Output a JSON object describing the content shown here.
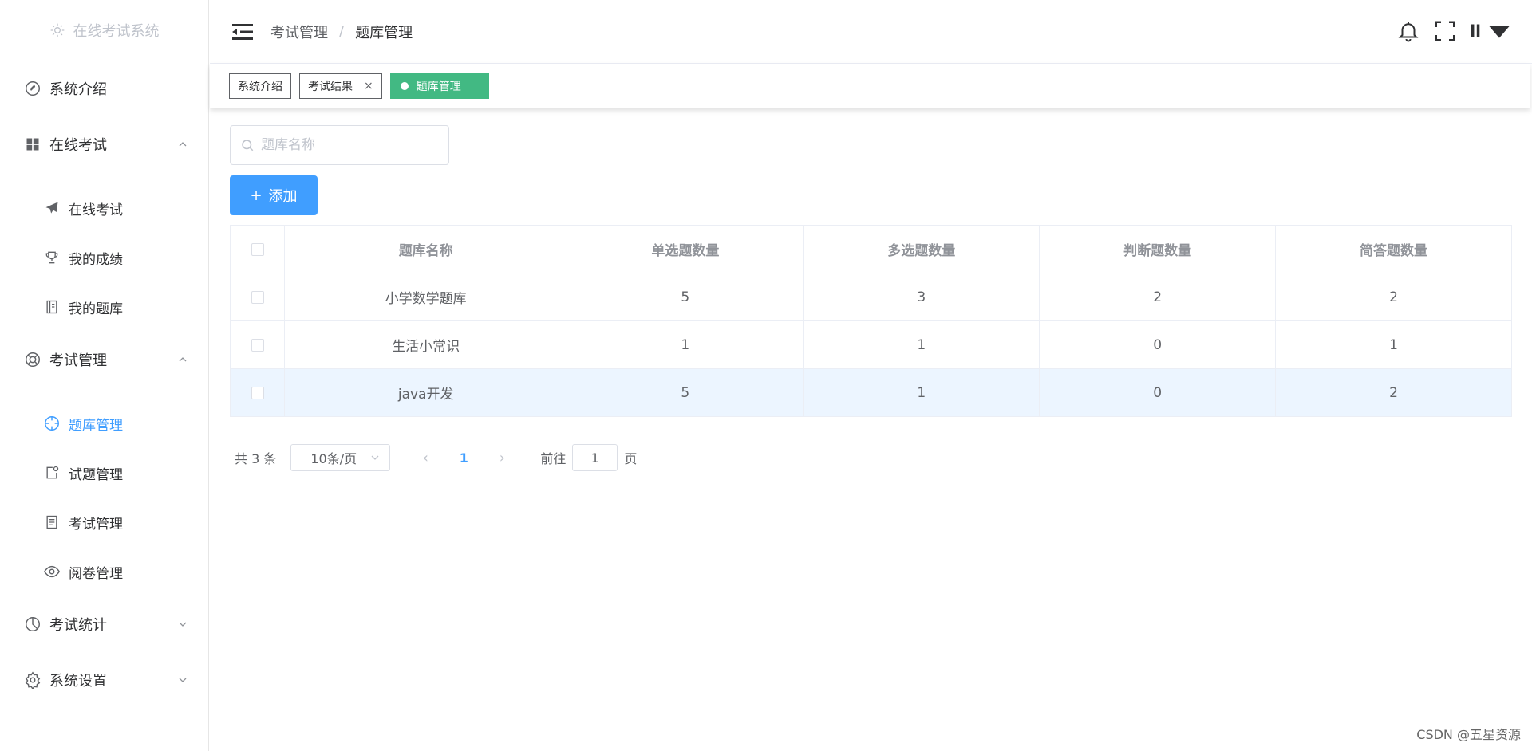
{
  "sidebar": {
    "logo_text": "在线考试系统",
    "items": [
      {
        "label": "系统介绍"
      },
      {
        "label": "在线考试",
        "children": [
          {
            "label": "在线考试"
          },
          {
            "label": "我的成绩"
          },
          {
            "label": "我的题库"
          }
        ]
      },
      {
        "label": "考试管理",
        "children": [
          {
            "label": "题库管理"
          },
          {
            "label": "试题管理"
          },
          {
            "label": "考试管理"
          },
          {
            "label": "阅卷管理"
          }
        ]
      },
      {
        "label": "考试统计"
      },
      {
        "label": "系统设置"
      }
    ]
  },
  "header": {
    "breadcrumb": [
      "考试管理",
      "题库管理"
    ],
    "breadcrumb_sep": "/",
    "user_label": "ll"
  },
  "tags": [
    {
      "label": "系统介绍"
    },
    {
      "label": "考试结果",
      "close": "×"
    },
    {
      "label": "题库管理"
    }
  ],
  "search": {
    "placeholder": "题库名称"
  },
  "add_button": {
    "label": "添加",
    "icon": "+"
  },
  "table": {
    "columns": [
      "题库名称",
      "单选题数量",
      "多选题数量",
      "判断题数量",
      "简答题数量"
    ],
    "rows": [
      [
        "小学数学题库",
        "5",
        "3",
        "2",
        "2"
      ],
      [
        "生活小常识",
        "1",
        "1",
        "0",
        "1"
      ],
      [
        "java开发",
        "5",
        "1",
        "0",
        "2"
      ]
    ]
  },
  "pagination": {
    "total": "共 3 条",
    "page_size": "10条/页",
    "prev": "‹",
    "current": "1",
    "next": "›",
    "goto_label": "前往",
    "goto_value": "1",
    "goto_suffix": "页"
  },
  "watermark": "CSDN @五星资源",
  "colors": {
    "accent": "#409eff",
    "active_tag": "#42b983"
  }
}
